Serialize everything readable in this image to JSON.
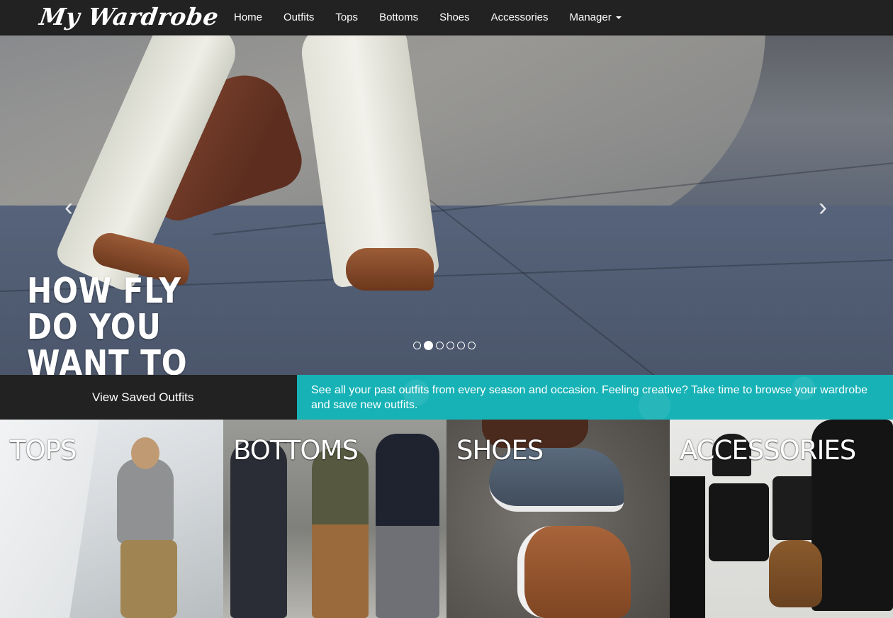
{
  "navbar": {
    "brand": "My Wardrobe",
    "items": [
      {
        "label": "Home"
      },
      {
        "label": "Outfits"
      },
      {
        "label": "Tops"
      },
      {
        "label": "Bottoms"
      },
      {
        "label": "Shoes"
      },
      {
        "label": "Accessories"
      },
      {
        "label": "Manager"
      }
    ]
  },
  "hero": {
    "headline": "HOW FLY DO YOU WANT TO LOOK TODAY?",
    "prev_icon": "chevron-left-icon",
    "next_icon": "chevron-right-icon",
    "prev_glyph": "‹",
    "next_glyph": "›",
    "slide_count": 6,
    "active_slide": 2
  },
  "cta": {
    "button_label": "View Saved Outfits",
    "description": "See all your past outfits from every season and occasion. Feeling creative? Take time to browse your wardrobe and save new outfits.",
    "left_bg": "#222222",
    "right_bg": "#17b2b6"
  },
  "categories": [
    {
      "label": "TOPS"
    },
    {
      "label": "BOTTOMS"
    },
    {
      "label": "SHOES"
    },
    {
      "label": "ACCESSORIES"
    }
  ],
  "colors": {
    "navbar_bg": "#222222",
    "accent_teal": "#17b2b6",
    "text_light": "#ffffff"
  }
}
